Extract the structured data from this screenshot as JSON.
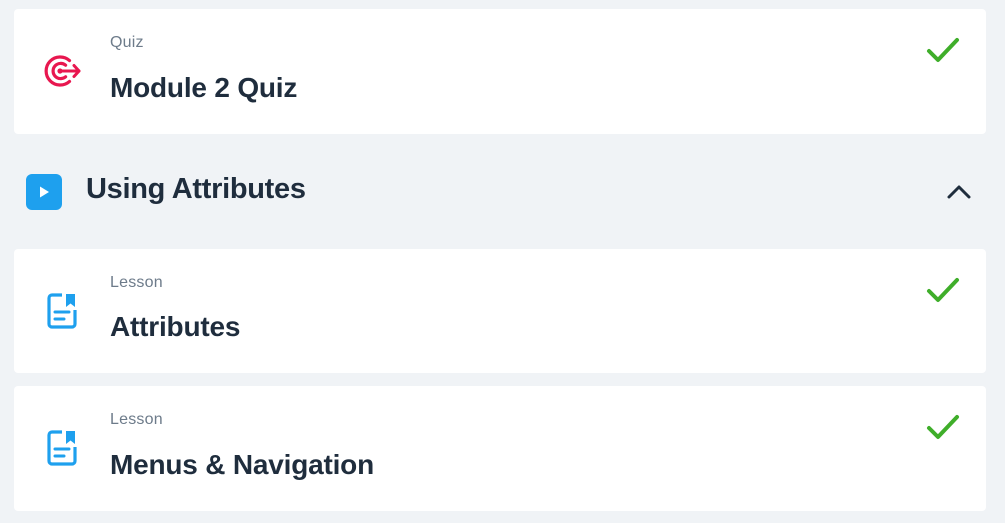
{
  "items_before": [
    {
      "kind": "Quiz",
      "title": "Module 2 Quiz",
      "icon": "target-icon",
      "completed": true
    }
  ],
  "section": {
    "title": "Using Attributes",
    "icon": "play-icon",
    "expanded": true
  },
  "items": [
    {
      "kind": "Lesson",
      "title": "Attributes",
      "icon": "lesson-icon",
      "completed": true
    },
    {
      "kind": "Lesson",
      "title": "Menus & Navigation",
      "icon": "lesson-icon",
      "completed": true
    }
  ],
  "colors": {
    "background": "#f0f3f6",
    "quiz_accent": "#e8174f",
    "lesson_accent": "#1ea0ee",
    "check": "#3fae2a",
    "title": "#1f2d3d",
    "kind": "#6d7b8a"
  }
}
